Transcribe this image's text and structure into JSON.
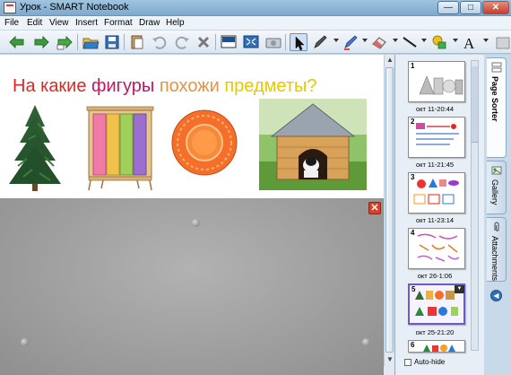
{
  "window": {
    "title": "Урок - SMART Notebook"
  },
  "menubar": {
    "items": [
      "File",
      "Edit",
      "View",
      "Insert",
      "Format",
      "Draw",
      "Help"
    ]
  },
  "toolbar": {
    "icons": [
      "previous-page-icon",
      "next-page-icon",
      "add-page-icon",
      "open-icon",
      "save-icon",
      "paste-icon",
      "undo-icon",
      "redo-icon",
      "delete-icon",
      "screen-shade-icon",
      "full-screen-icon",
      "capture-icon",
      "select-icon",
      "pen-icon",
      "creative-pen-icon",
      "eraser-icon",
      "line-icon",
      "shapes-icon",
      "text-icon",
      "fill-icon"
    ]
  },
  "lesson": {
    "question_words": [
      "На какие",
      "фигуры",
      "похожи",
      "предметы?"
    ],
    "pictures": [
      "fir-tree",
      "wardrobe",
      "plate",
      "doghouse"
    ]
  },
  "sorter": {
    "pages": [
      {
        "num": "1",
        "label": "окт 11-20:44"
      },
      {
        "num": "2",
        "label": "окт 11-21:45"
      },
      {
        "num": "3",
        "label": "окт 11-23:14"
      },
      {
        "num": "4",
        "label": "окт 26-1:06"
      },
      {
        "num": "5",
        "label": "окт 25-21:20"
      },
      {
        "num": "6",
        "label": ""
      }
    ],
    "autohide_label": "Auto-hide"
  },
  "tabs": {
    "page_sorter": "Page Sorter",
    "gallery": "Gallery",
    "attachments": "Attachments"
  },
  "colors": {
    "accent": "#6a5acd",
    "titlebar": "#8fb6d8",
    "close": "#d8402b"
  }
}
